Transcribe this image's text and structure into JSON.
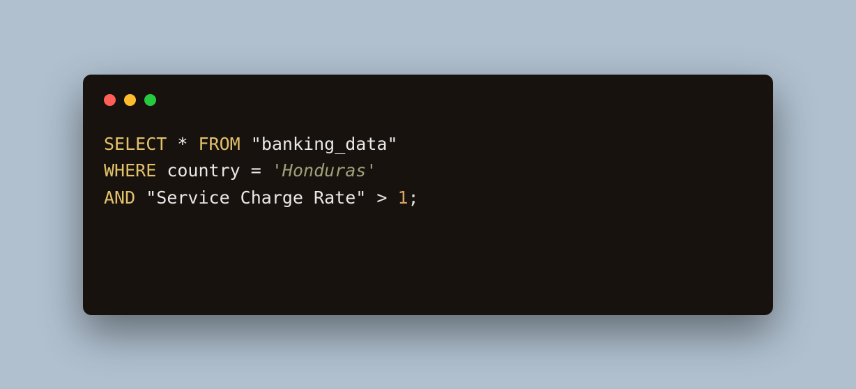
{
  "code": {
    "line1": {
      "select": "SELECT",
      "star": "*",
      "from": "FROM",
      "table": "\"banking_data\""
    },
    "line2": {
      "where": "WHERE",
      "column": "country",
      "eq": "=",
      "value": "'Honduras'"
    },
    "line3": {
      "and": "AND",
      "column": "\"Service Charge Rate\"",
      "op": ">",
      "value": "1",
      "semi": ";"
    }
  }
}
